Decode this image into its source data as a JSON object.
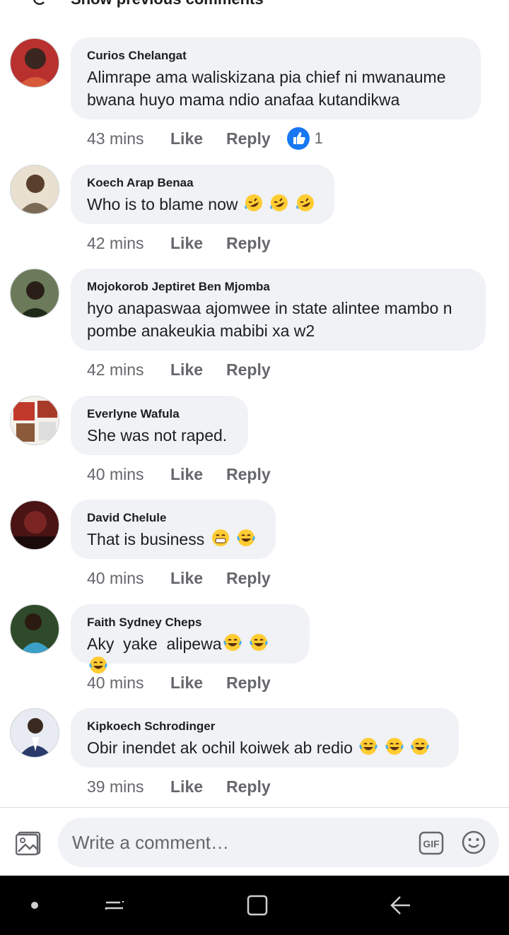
{
  "header": {
    "show_previous_label": "Show previous comments"
  },
  "comments": [
    {
      "author": "Curios Chelangat",
      "text": "Alimrape ama waliskizana pia chief ni mwanaume bwana huyo mama ndio anafaa kutandikwa",
      "time": "43 mins",
      "like": "Like",
      "reply": "Reply",
      "reaction_count": "1",
      "avatar_color": "#b8312f"
    },
    {
      "author": "Koech Arap Benaa",
      "text": "Who is to blame now",
      "emoji": [
        "rofl-emoji",
        "rofl-emoji",
        "rofl-emoji"
      ],
      "time": "42 mins",
      "like": "Like",
      "reply": "Reply",
      "avatar_color": "#c9b79c"
    },
    {
      "author": "Mojokorob Jeptiret Ben Mjomba",
      "text": "hyo anapaswaa ajomwee in state alintee mambo n pombe anakeukia mabibi xa w2",
      "time": "42 mins",
      "like": "Like",
      "reply": "Reply",
      "avatar_color": "#5a6e4a"
    },
    {
      "author": "Everlyne Wafula",
      "text": "She was not raped.",
      "time": "40 mins",
      "like": "Like",
      "reply": "Reply",
      "avatar_color": "#a83a2a"
    },
    {
      "author": "David Chelule",
      "text": "That is business",
      "emoji": [
        "grin-sweat-emoji",
        "joy-emoji"
      ],
      "time": "40 mins",
      "like": "Like",
      "reply": "Reply",
      "avatar_color": "#5a1e1e"
    },
    {
      "author": "Faith Sydney Cheps",
      "text": "Aky  yake  alipewa",
      "emoji": [
        "joy-emoji",
        "joy-emoji",
        "joy-emoji"
      ],
      "time": "40 mins",
      "like": "Like",
      "reply": "Reply",
      "avatar_color": "#2f6f8a"
    },
    {
      "author": "Kipkoech Schrodinger",
      "text": "Obir inendet ak ochil koiwek ab redio",
      "emoji": [
        "joy-emoji",
        "joy-emoji",
        "joy-emoji"
      ],
      "time": "39 mins",
      "like": "Like",
      "reply": "Reply",
      "avatar_color": "#3a4a7a"
    }
  ],
  "composer": {
    "placeholder": "Write a comment…",
    "gif_label": "GIF"
  },
  "colors": {
    "bubble": "#f0f2f5",
    "meta_text": "#65676b",
    "like_blue": "#1877f2",
    "emoji_yellow": "#ffcc33"
  }
}
